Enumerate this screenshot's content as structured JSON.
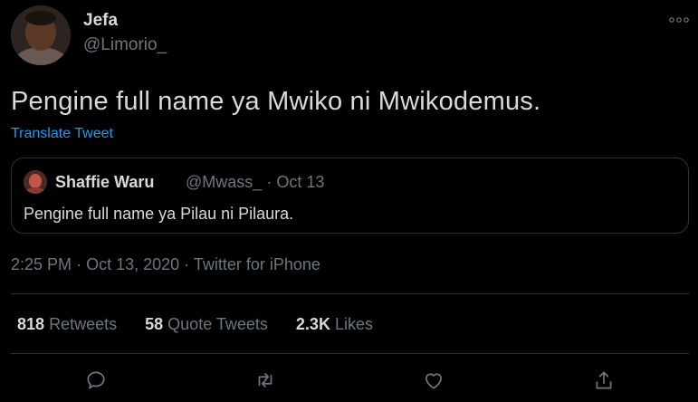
{
  "author": {
    "name": "Jefa",
    "handle": "@Limorio_"
  },
  "tweet": {
    "text": "Pengine full name ya Mwiko ni Mwikodemus.",
    "translate_label": "Translate Tweet"
  },
  "quoted": {
    "name": "Shaffie Waru",
    "handle": "@Mwass_",
    "separator": "·",
    "date": "Oct 13",
    "text": "Pengine full name ya Pilau ni Pilaura."
  },
  "timestamp": {
    "time": "2:25 PM",
    "sep1": "·",
    "date": "Oct 13, 2020",
    "sep2": "·",
    "source": "Twitter for iPhone"
  },
  "stats": [
    {
      "count": "818",
      "label": "Retweets"
    },
    {
      "count": "58",
      "label": "Quote Tweets"
    },
    {
      "count": "2.3K",
      "label": "Likes"
    }
  ],
  "actions": [
    "reply-icon",
    "retweet-icon",
    "like-icon",
    "share-icon"
  ],
  "colors": {
    "background": "#000000",
    "text": "#d9d9d9",
    "secondary": "#6e767d",
    "link": "#1d9bf0",
    "border": "#2f3336"
  }
}
